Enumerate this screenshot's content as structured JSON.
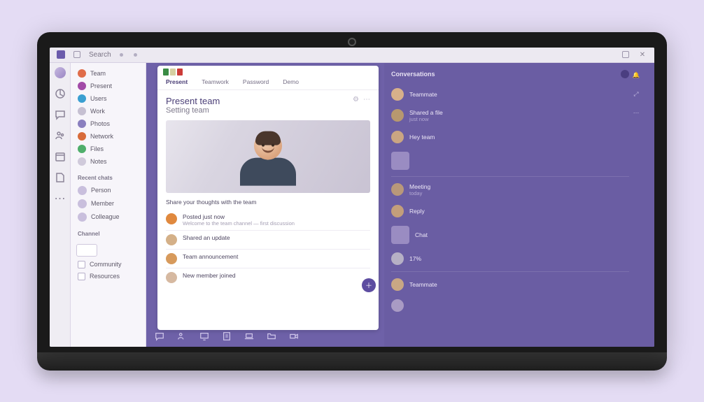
{
  "titlebar": {
    "label": "Search"
  },
  "sidebar": {
    "items": [
      {
        "label": "Team",
        "color": "#e06d4a"
      },
      {
        "label": "Present",
        "color": "#a24aa8"
      },
      {
        "label": "Users",
        "color": "#3a9fd1"
      },
      {
        "label": "Work",
        "color": "#c6c0d2"
      },
      {
        "label": "Photos",
        "color": "#8a7fbf"
      },
      {
        "label": "Network",
        "color": "#d86b3b"
      },
      {
        "label": "Files",
        "color": "#4fae6b"
      },
      {
        "label": "Notes",
        "color": "#d0cadb"
      }
    ],
    "section_a": "Recent chats",
    "people": [
      {
        "label": "Person"
      },
      {
        "label": "Member"
      },
      {
        "label": "Colleague"
      }
    ],
    "section_b": "Channel",
    "link_a": "Community",
    "link_b": "Resources"
  },
  "tabs": [
    {
      "label": "Present"
    },
    {
      "label": "Teamwork"
    },
    {
      "label": "Password"
    },
    {
      "label": "Demo"
    }
  ],
  "card": {
    "title": "Present team",
    "subtitle": "Setting team"
  },
  "feed": {
    "hint": "Share your thoughts with the team",
    "items": [
      {
        "l1": "Posted just now",
        "l2": "Welcome to the team channel — first discussion",
        "color": "#e0893e"
      },
      {
        "l1": "Shared an update",
        "l2": "",
        "color": "#d4b088"
      },
      {
        "l1": "Team announcement",
        "l2": "",
        "color": "#d79a5c"
      },
      {
        "l1": "New member joined",
        "l2": "",
        "color": "#d6b9a1"
      }
    ]
  },
  "right": {
    "heading": "Conversations",
    "items": [
      {
        "l1": "Teammate",
        "l2": "",
        "av": "#d8b08a"
      },
      {
        "l1": "Shared a file",
        "l2": "just now",
        "av": "#b7986f"
      },
      {
        "l1": "Hey team",
        "l2": "",
        "av": "#caa582"
      },
      {
        "l1": "",
        "l2": "",
        "thumb": true
      },
      {
        "l1": "Meeting",
        "l2": "today",
        "av": "#b9987a"
      },
      {
        "l1": "Reply",
        "l2": "",
        "av": "#c39e7b"
      },
      {
        "l1": "Chat",
        "l2": "",
        "thumb": true
      },
      {
        "l1": "17%",
        "l2": "",
        "av": "#b6b0c5"
      },
      {
        "l1": "Teammate",
        "l2": "",
        "av": "#c9a784"
      },
      {
        "l1": "",
        "l2": "",
        "av": "#a99bc4"
      }
    ]
  }
}
